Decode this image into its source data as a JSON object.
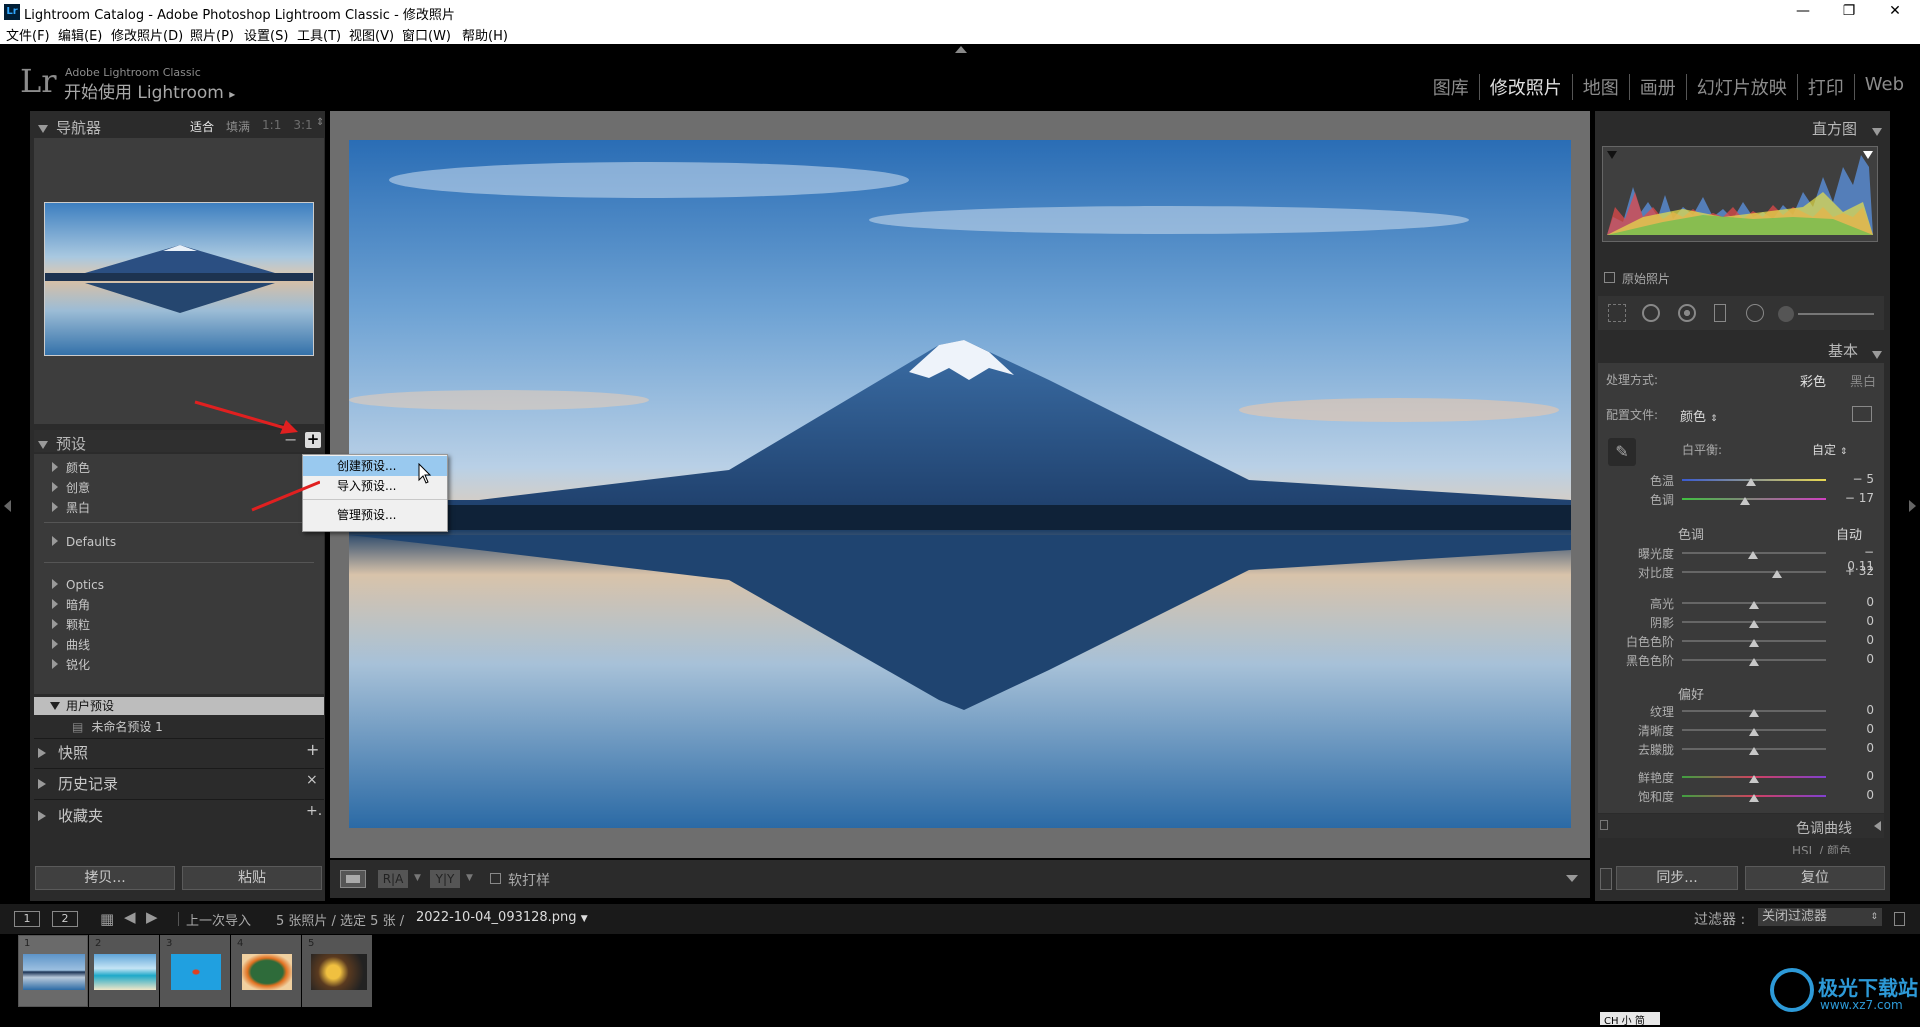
{
  "window": {
    "app_icon": "Lr",
    "title": "Lightroom Catalog - Adobe Photoshop Lightroom Classic - 修改照片",
    "controls": [
      "minimize-icon",
      "restore-icon",
      "close-icon"
    ]
  },
  "menu": [
    "文件(F)",
    "编辑(E)",
    "修改照片(D)",
    "照片(P)",
    "设置(S)",
    "工具(T)",
    "视图(V)",
    "窗口(W)",
    "帮助(H)"
  ],
  "identity": {
    "logo": "Lr",
    "product": "Adobe Lightroom Classic",
    "subtitle": "开始使用 Lightroom",
    "arrow": "▸"
  },
  "modules": [
    {
      "label": "图库",
      "active": false
    },
    {
      "label": "修改照片",
      "active": true
    },
    {
      "label": "地图",
      "active": false
    },
    {
      "label": "画册",
      "active": false
    },
    {
      "label": "幻灯片放映",
      "active": false
    },
    {
      "label": "打印",
      "active": false
    },
    {
      "label": "Web",
      "active": false
    }
  ],
  "navigator": {
    "title": "导航器",
    "zoom_options": [
      "适合",
      "填满",
      "1:1",
      "3:1"
    ],
    "zoom_selected": "适合"
  },
  "presets": {
    "title": "预设",
    "minus": "−",
    "plus": "+",
    "groups_a": [
      "颜色",
      "创意",
      "黑白"
    ],
    "groups_b": [
      "Defaults"
    ],
    "groups_c": [
      "Optics",
      "暗角",
      "颗粒",
      "曲线",
      "锐化"
    ],
    "user_group": "用户预设",
    "user_item": "未命名预设 1"
  },
  "context_menu": {
    "items": [
      "创建预设...",
      "导入预设...",
      "管理预设..."
    ],
    "highlighted": "创建预设..."
  },
  "snapshots": {
    "title": "快照",
    "action": "+"
  },
  "history": {
    "title": "历史记录",
    "action": "×"
  },
  "collections": {
    "title": "收藏夹",
    "action": "+."
  },
  "left_buttons": {
    "copy": "拷贝...",
    "paste": "粘贴"
  },
  "toolbar": {
    "view_icon": "loupe-view-icon",
    "before_after_1": "R|A",
    "before_after_2": "Y|Y",
    "soft_proof": "软打样"
  },
  "histogram": {
    "title": "直方图",
    "original": "原始照片"
  },
  "basic": {
    "title": "基本",
    "treatment_label": "处理方式:",
    "treatment_color": "彩色",
    "treatment_bw": "黑白",
    "profile_label": "配置文件:",
    "profile_value": "颜色",
    "wb_label": "白平衡:",
    "wb_value": "自定",
    "tone_label": "色调",
    "tone_auto": "自动",
    "presence_label": "偏好",
    "sliders_wb": [
      {
        "label": "色温",
        "value": "− 5",
        "pos": 0.48
      },
      {
        "label": "色调",
        "value": "− 17",
        "pos": 0.44
      }
    ],
    "sliders_tone": [
      {
        "label": "曝光度",
        "value": "− 0.11",
        "pos": 0.49
      },
      {
        "label": "对比度",
        "value": "+ 32",
        "pos": 0.66
      }
    ],
    "sliders_tone2": [
      {
        "label": "高光",
        "value": "0",
        "pos": 0.5
      },
      {
        "label": "阴影",
        "value": "0",
        "pos": 0.5
      },
      {
        "label": "白色色阶",
        "value": "0",
        "pos": 0.5
      },
      {
        "label": "黑色色阶",
        "value": "0",
        "pos": 0.5
      }
    ],
    "sliders_presence": [
      {
        "label": "纹理",
        "value": "0",
        "pos": 0.5
      },
      {
        "label": "清晰度",
        "value": "0",
        "pos": 0.5
      },
      {
        "label": "去朦胧",
        "value": "0",
        "pos": 0.5
      }
    ],
    "sliders_presence2": [
      {
        "label": "鲜艳度",
        "value": "0",
        "pos": 0.5
      },
      {
        "label": "饱和度",
        "value": "0",
        "pos": 0.5
      }
    ]
  },
  "tone_curve": {
    "title": "色调曲线"
  },
  "hsl": {
    "title": "HSL / 颜色"
  },
  "right_buttons": {
    "sync": "同步...",
    "reset": "复位"
  },
  "filmbar": {
    "screen1": "1",
    "screen2": "2",
    "source": "上一次导入",
    "count": "5 张照片 / 选定 5 张 /",
    "filename": "2022-10-04_093128.png",
    "filter_label": "过滤器 :",
    "filter_value": "关闭过滤器"
  },
  "thumbs": [
    "1",
    "2",
    "3",
    "4",
    "5"
  ],
  "taskbar_ime": "CH 小 简",
  "watermark": {
    "text": "极光下载站",
    "url": "www.xz7.com"
  },
  "colors": {
    "bg": "#000000",
    "panel": "#2b2b2b",
    "center": "#6e6e6e",
    "accent_arrow": "#e02020",
    "menu_highlight": "#99c9ef"
  }
}
